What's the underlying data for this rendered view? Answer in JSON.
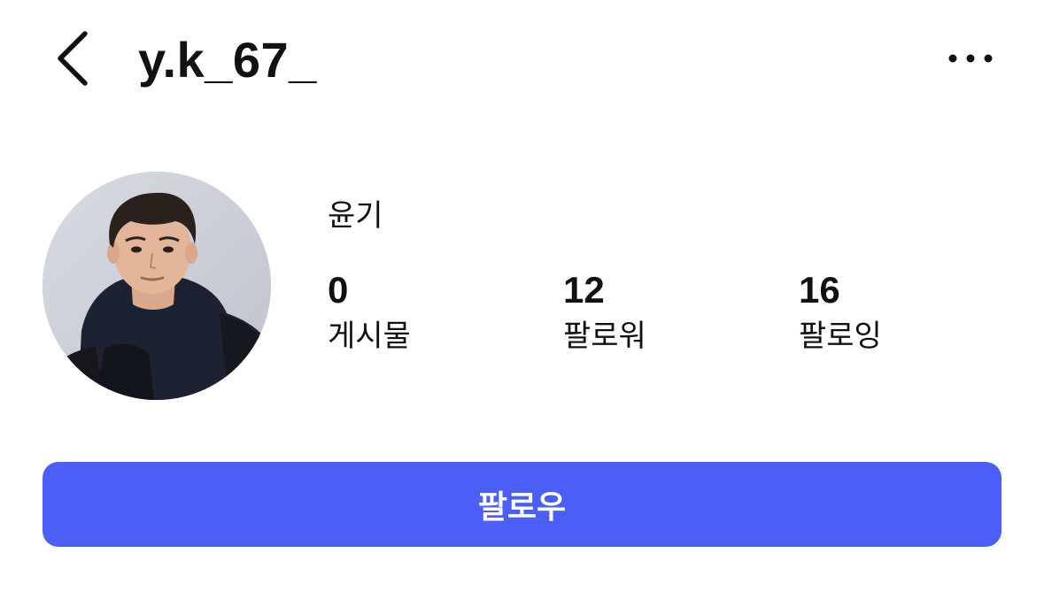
{
  "header": {
    "username": "y.k_67_",
    "back_icon": "chevron-left-icon",
    "more_icon": "more-horizontal-icon"
  },
  "profile": {
    "display_name": "윤기",
    "avatar_icon": "profile-photo"
  },
  "stats": [
    {
      "count": "0",
      "label": "게시물"
    },
    {
      "count": "12",
      "label": "팔로워"
    },
    {
      "count": "16",
      "label": "팔로잉"
    }
  ],
  "actions": {
    "follow_label": "팔로우"
  },
  "colors": {
    "accent": "#4b5ff6",
    "text": "#111111",
    "background": "#ffffff"
  }
}
